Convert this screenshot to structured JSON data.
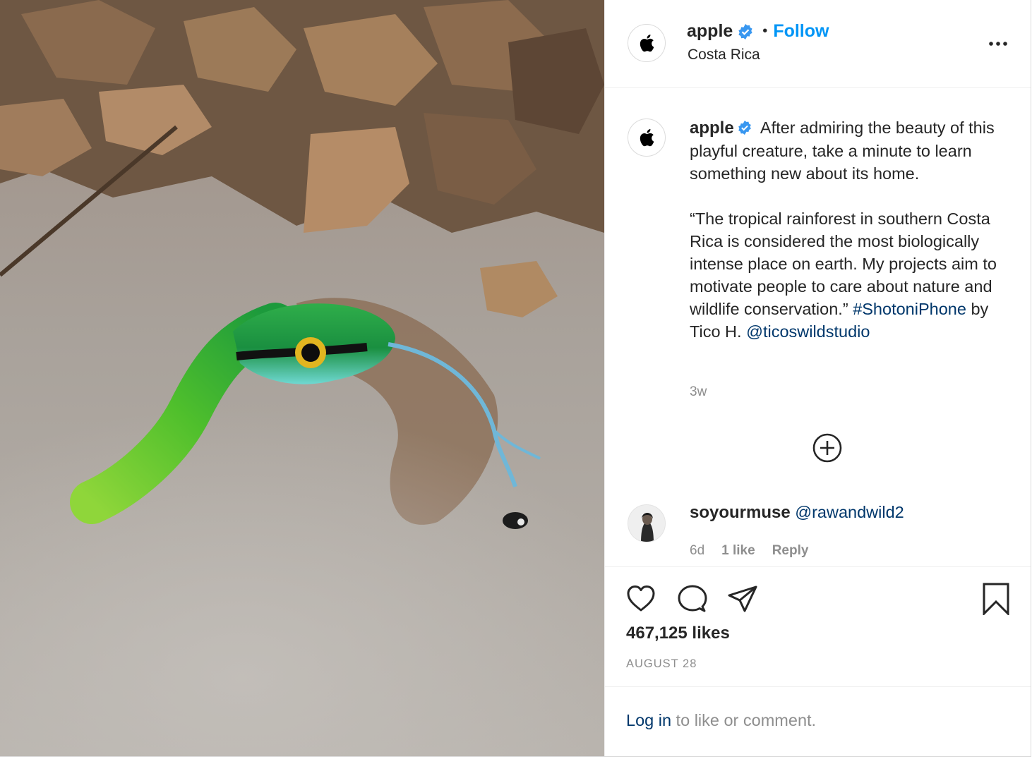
{
  "post": {
    "username": "apple",
    "follow_label": "Follow",
    "separator": "•",
    "location": "Costa Rica"
  },
  "caption": {
    "username": "apple",
    "text_1": " After admiring the beauty of this playful creature, take a minute to learn something new about its home.\n\n“The tropical rainforest in southern Costa Rica is considered the most biologically intense place on earth. My projects aim to motivate people to care about nature and wildlife conservation.” ",
    "hashtag": "#ShotoniPhone",
    "text_2": " by Tico H. ",
    "mention": "@ticoswildstudio",
    "time_ago": "3w"
  },
  "comment": {
    "username": "soyourmuse",
    "mention": "@rawandwild2",
    "time_ago": "6d",
    "likes": "1 like",
    "reply_label": "Reply"
  },
  "stats": {
    "likes": "467,125 likes",
    "date": "AUGUST 28"
  },
  "login": {
    "link": "Log in",
    "rest": " to like or comment."
  },
  "colors": {
    "accent": "#0095f6",
    "link": "#00376b",
    "muted": "#8e8e8e",
    "text": "#262626"
  },
  "icons": [
    "apple-logo-icon",
    "verified-badge-icon",
    "more-options-icon",
    "load-more-icon",
    "heart-icon",
    "comment-icon",
    "share-icon",
    "bookmark-icon"
  ]
}
